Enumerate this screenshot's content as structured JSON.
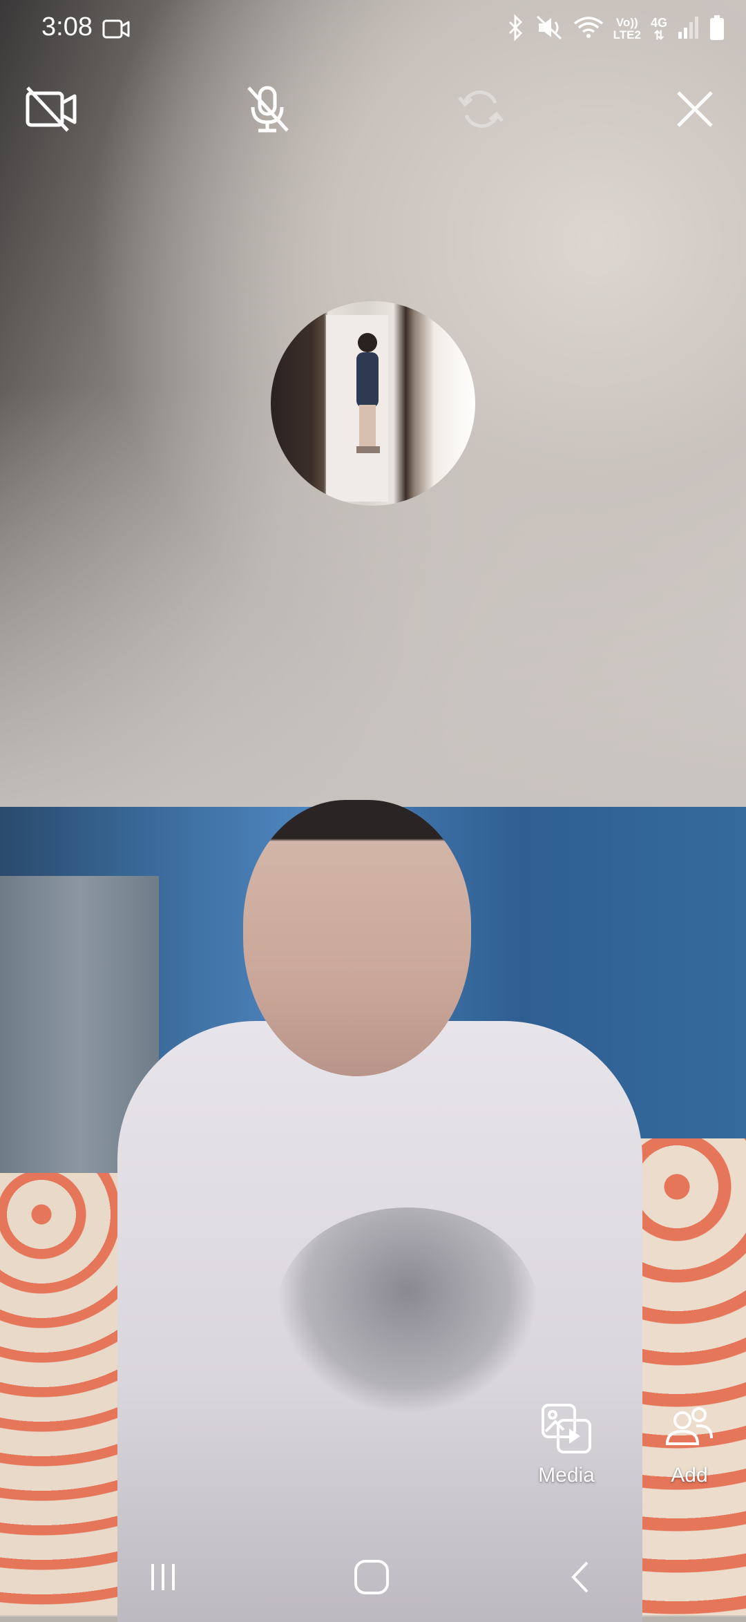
{
  "status_bar": {
    "time": "3:08",
    "network_label_top": "Vo))",
    "network_label_bottom": "LTE2",
    "network_type": "4G"
  },
  "call_controls": {
    "items": [
      {
        "name": "video-off",
        "icon": "video-off-icon"
      },
      {
        "name": "mic-off",
        "icon": "mic-off-icon"
      },
      {
        "name": "switch-camera",
        "icon": "switch-camera-icon",
        "disabled": true
      },
      {
        "name": "end-call",
        "icon": "close-icon"
      }
    ]
  },
  "side_actions": {
    "media_label": "Media",
    "add_label": "Add"
  },
  "nav": {
    "recents": "recents-icon",
    "home": "home-icon",
    "back": "back-icon"
  }
}
